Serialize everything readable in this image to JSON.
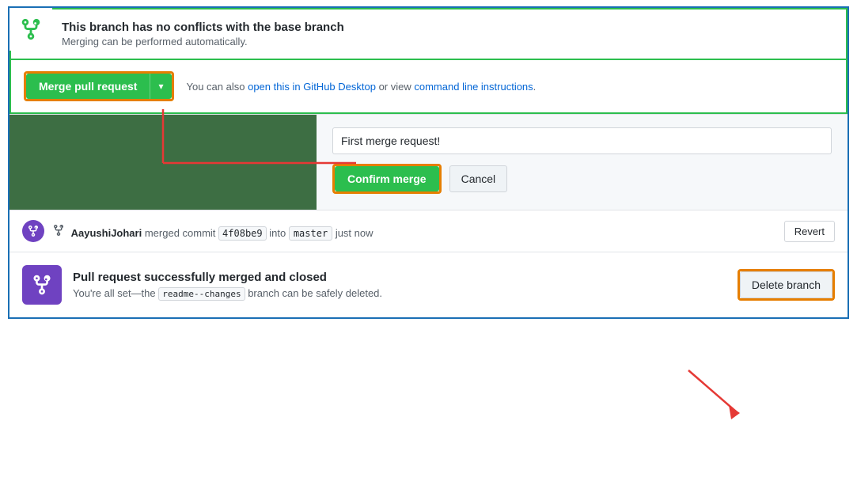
{
  "section1": {
    "title": "This branch has no conflicts with the base branch",
    "subtitle": "Merging can be performed automatically."
  },
  "section2": {
    "merge_btn_label": "Merge pull request",
    "arrow_label": "▾",
    "helper_text_prefix": "You can also ",
    "helper_link1": "open this in GitHub Desktop",
    "helper_text_mid": " or view ",
    "helper_link2": "command line instructions",
    "helper_text_suffix": "."
  },
  "section3": {
    "input_placeholder": "First merge request!",
    "confirm_btn_label": "Confirm merge",
    "cancel_btn_label": "Cancel"
  },
  "section4": {
    "username": "AayushiJohari",
    "action": "merged commit",
    "commit_hash": "4f08be9",
    "into_text": "into",
    "branch": "master",
    "time": "just now",
    "revert_label": "Revert"
  },
  "section5": {
    "title": "Pull request successfully merged and closed",
    "subtitle_prefix": "You're all set—the ",
    "branch_name": "readme--changes",
    "subtitle_suffix": " branch can be safely deleted.",
    "delete_btn_label": "Delete branch"
  }
}
